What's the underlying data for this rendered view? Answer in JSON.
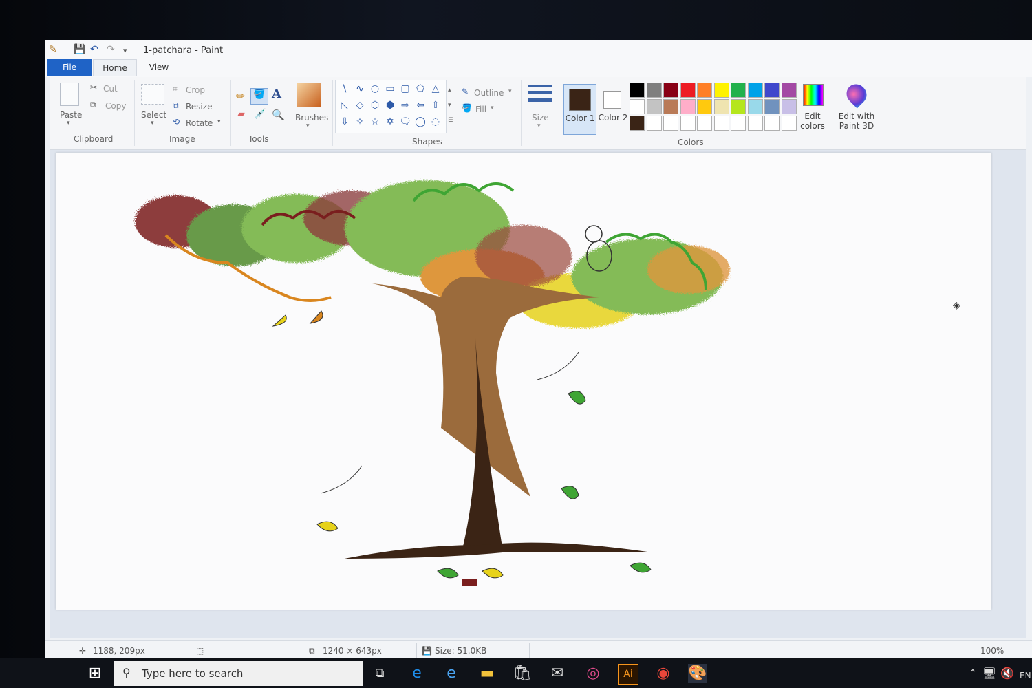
{
  "window": {
    "title": "1-patchara - Paint"
  },
  "quick_access": {
    "save_icon": "save-icon",
    "undo_icon": "undo-icon",
    "redo_icon": "redo-icon"
  },
  "tabs": [
    {
      "label": "File"
    },
    {
      "label": "Home"
    },
    {
      "label": "View"
    }
  ],
  "clipboard": {
    "paste_label": "Paste",
    "cut_label": "Cut",
    "copy_label": "Copy",
    "group_label": "Clipboard"
  },
  "image": {
    "select_label": "Select",
    "crop_label": "Crop",
    "resize_label": "Resize",
    "rotate_label": "Rotate",
    "group_label": "Image"
  },
  "tools": {
    "group_label": "Tools",
    "text_glyph": "A"
  },
  "brushes": {
    "label": "Brushes"
  },
  "shapes": {
    "outline_label": "Outline",
    "fill_label": "Fill",
    "group_label": "Shapes",
    "glyphs": [
      "\\",
      "∿",
      "○",
      "▭",
      "▢",
      "⬠",
      "△",
      "◺",
      "◇",
      "⬡",
      "⬢",
      "⇨",
      "⇦",
      "⇧",
      "⇩",
      "✧",
      "☆",
      "✡",
      "🗨",
      "◯",
      "◌"
    ]
  },
  "size": {
    "label": "Size"
  },
  "colors": {
    "color1_label": "Color 1",
    "color2_label": "Color 2",
    "group_label": "Colors",
    "edit_colors_label": "Edit colors",
    "edit_paint3d_label": "Edit with Paint 3D",
    "color1": "#3a2416",
    "color2": "#ffffff",
    "palette_row1": [
      "#000000",
      "#7f7f7f",
      "#880015",
      "#ed1c24",
      "#ff7f27",
      "#fff200",
      "#22b14c",
      "#00a2e8",
      "#3f48cc",
      "#a349a4"
    ],
    "palette_row2": [
      "#ffffff",
      "#c3c3c3",
      "#b97a57",
      "#ffaec9",
      "#ffc90e",
      "#efe4b0",
      "#b5e61d",
      "#99d9ea",
      "#7092be",
      "#c8bfe7"
    ],
    "palette_row3": [
      "#3a2416",
      "#ffffff",
      "#ffffff",
      "#ffffff",
      "#ffffff",
      "#ffffff",
      "#ffffff",
      "#ffffff",
      "#ffffff",
      "#ffffff"
    ]
  },
  "status": {
    "cursor_pos": "1188, 209px",
    "image_size": "1240 × 643px",
    "file_size": "Size: 51.0KB",
    "zoom": "100%"
  },
  "taskbar": {
    "search_placeholder": "Type here to search",
    "lang": "EN"
  }
}
